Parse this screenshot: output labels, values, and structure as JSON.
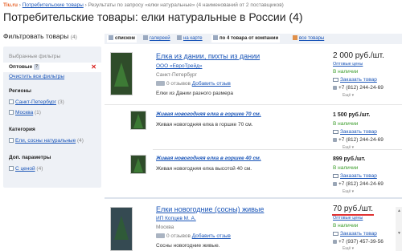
{
  "breadcrumb": {
    "logo": "Tiu.ru",
    "sep1": "›",
    "link": "Потребительские товары",
    "sep2": "›",
    "tail": "Результаты по запросу «елки натуральные» (4 наименований от 2 поставщиков)"
  },
  "page_title": "Потребительские товары: елки натуральные в России (4)",
  "filter": {
    "title": "Фильтровать товары",
    "count": "(4)",
    "selected_header": "Выбранные фильтры",
    "selected_label": "Оптовые",
    "selected_badge": "?",
    "clear_all": "Очистить все фильтры",
    "regions_header": "Регионы",
    "regions": [
      {
        "label": "Санкт-Петербург",
        "count": "(3)"
      },
      {
        "label": "Москва",
        "count": "(1)"
      }
    ],
    "category_header": "Категория",
    "categories": [
      {
        "label": "Ели, сосны натуральные",
        "count": "(4)"
      }
    ],
    "extra_header": "Доп. параметры",
    "extras": [
      {
        "label": "С ценой",
        "count": "(4)"
      }
    ]
  },
  "view_tabs": {
    "list": "списком",
    "gallery": "галереей",
    "map": "на карте",
    "by_company": "по 4 товара от компании",
    "all": "все товары"
  },
  "products": [
    {
      "name": "Елка из дании, пихты из дании",
      "company": "ООО «ЕвроТрейд»",
      "city": "Санкт-Петербург",
      "reviews": "0 отзывов",
      "add_review": "Добавить отзыв",
      "desc": "Елки из Дании разного размера",
      "price": "2 000 руб./шт.",
      "wholesale": "Оптовые цены",
      "availability": "В наличии",
      "order": "Заказать товар",
      "phone": "+7 (812) 244-24-69",
      "more": "Ещё ▾"
    },
    {
      "name": "Живая новогодняя елка в горшке 70 см.",
      "desc": "Живая новогодняя елка в горшке 70 см.",
      "price": "1 500 руб./шт.",
      "availability": "В наличии",
      "order": "Заказать товар",
      "phone": "+7 (812) 244-24-69",
      "more": "Ещё ▾"
    },
    {
      "name": "Живая новогодняя елка в горшке 40 см.",
      "desc": "Живая новогодняя елка высотой 40 см.",
      "price": "899 руб./шт.",
      "availability": "В наличии",
      "order": "Заказать товар",
      "phone": "+7 (812) 244-24-69",
      "more": "Ещё ▾"
    },
    {
      "name": "Елки новогодние (сосны) живые",
      "company": "ИП Копцев М. А.",
      "city": "Москва",
      "reviews": "0 отзывов",
      "add_review": "Добавить отзыв",
      "desc": "Сосны новогодние живые.",
      "price": "70 руб./шт.",
      "wholesale": "Оптовые цены",
      "availability": "В наличии",
      "order": "Заказать товар",
      "phone": "+7 (937) 457-39-56",
      "more": "Ещё ▾"
    }
  ],
  "colors": {
    "link": "#1a55b8",
    "available": "#3a9c2a",
    "highlight": "#e03131",
    "sidebar_bg": "#eef1f6"
  }
}
